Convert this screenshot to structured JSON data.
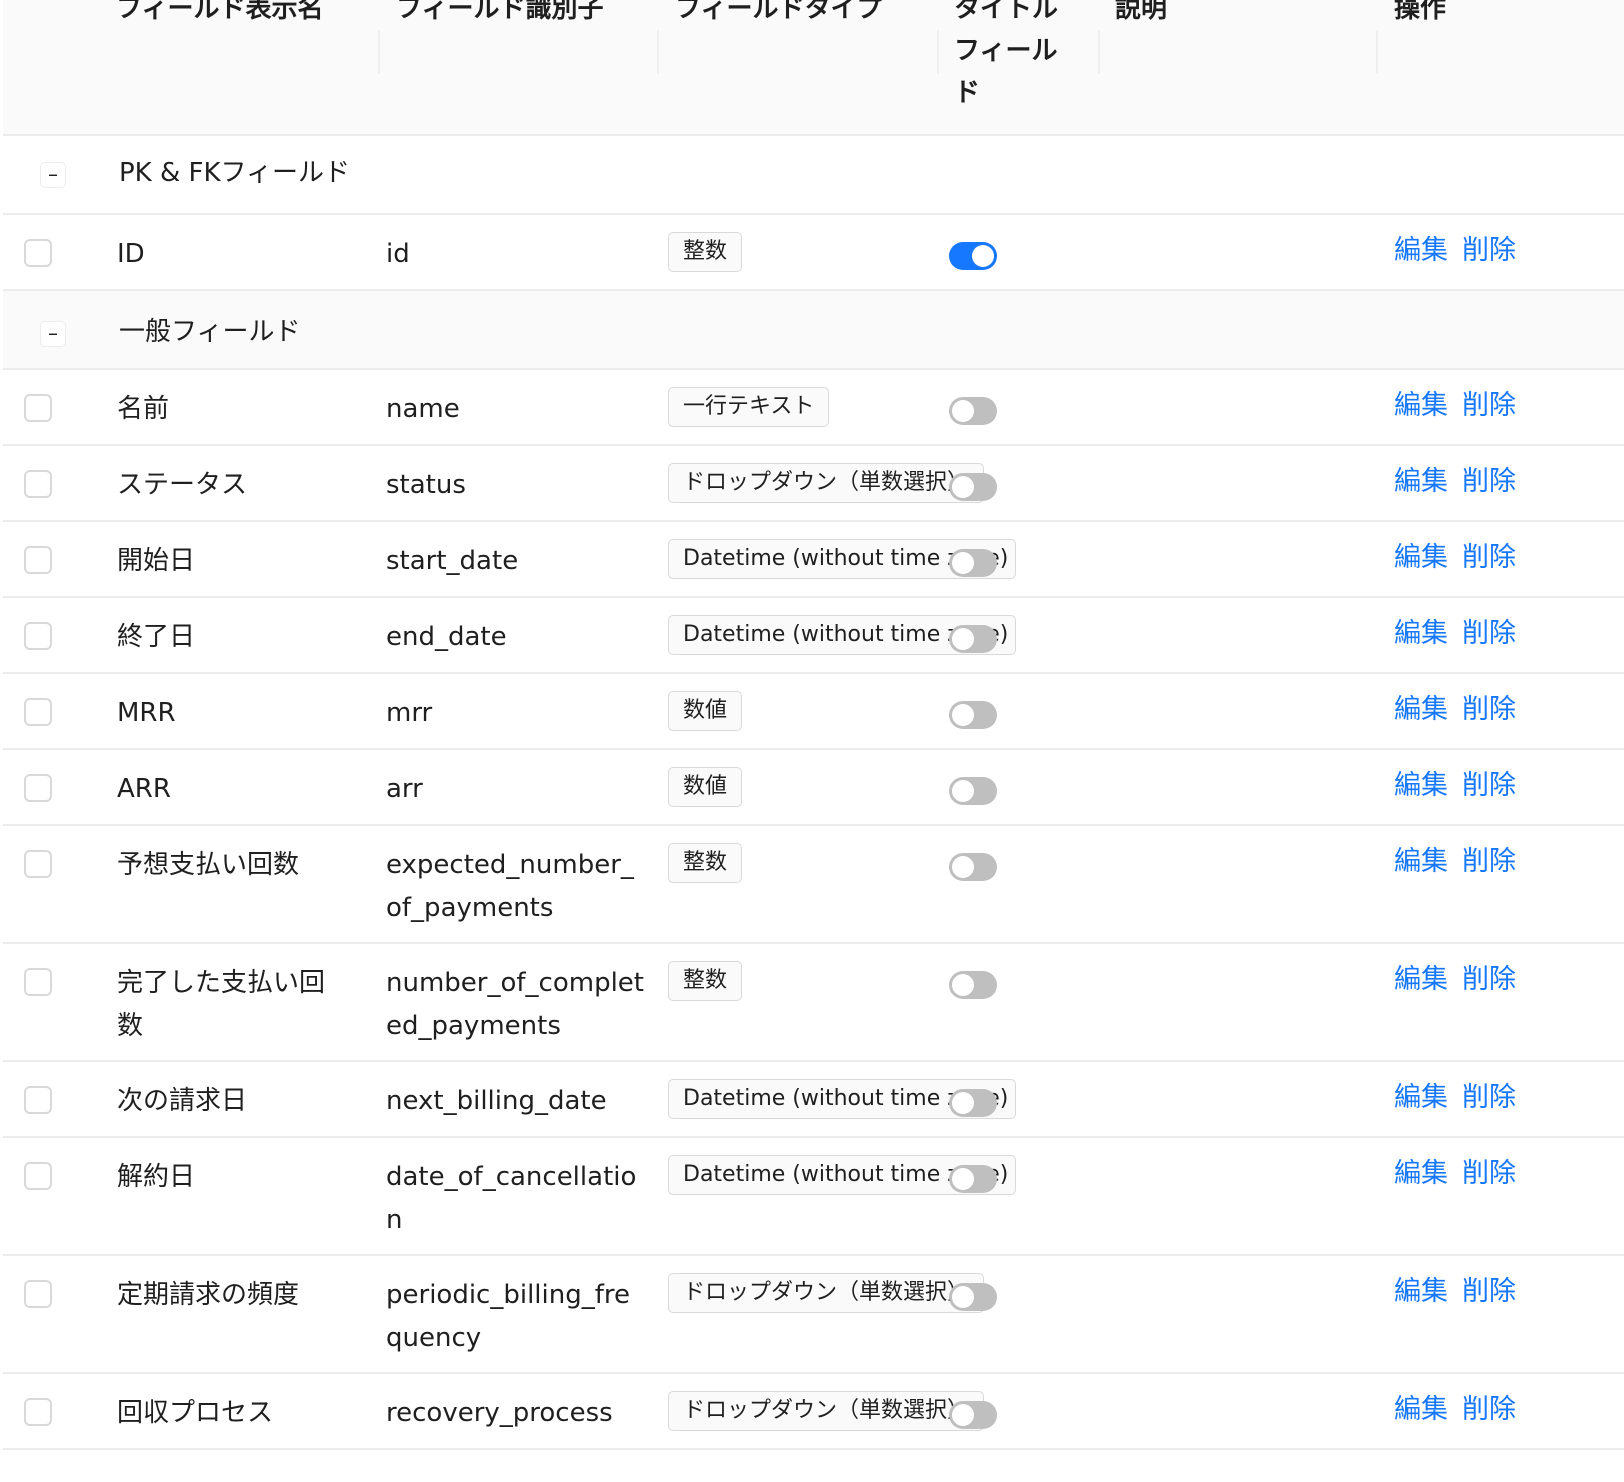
{
  "columns": {
    "display_name": "フィールド表示名",
    "identifier": "フィールド識別子",
    "type": "フィールドタイプ",
    "title_field": "タイトルフィールド",
    "title_field_lines": [
      "タイトル",
      "フィール",
      "ド"
    ],
    "description": "説明",
    "actions": "操作"
  },
  "groups": {
    "pk": {
      "label": "PK & FKフィールド",
      "expand_symbol": "–"
    },
    "general": {
      "label": "一般フィールド",
      "expand_symbol": "–"
    }
  },
  "action_labels": {
    "edit": "編集",
    "delete": "削除"
  },
  "colors": {
    "accent": "#1677ff",
    "toggle_off": "#bfbfbf",
    "header_bg": "#fafafa"
  },
  "rows": [
    {
      "name": "ID",
      "id": "id",
      "type": "整数",
      "title_field": true,
      "group": "pk"
    },
    {
      "name": "名前",
      "id": "name",
      "type": "一行テキスト",
      "title_field": false,
      "group": "general"
    },
    {
      "name": "ステータス",
      "id": "status",
      "type": "ドロップダウン（単数選択）",
      "title_field": false,
      "group": "general"
    },
    {
      "name": "開始日",
      "id": "start_date",
      "type": "Datetime (without time zone)",
      "title_field": false,
      "group": "general"
    },
    {
      "name": "終了日",
      "id": "end_date",
      "type": "Datetime (without time zone)",
      "title_field": false,
      "group": "general"
    },
    {
      "name": "MRR",
      "id": "mrr",
      "type": "数値",
      "title_field": false,
      "group": "general"
    },
    {
      "name": "ARR",
      "id": "arr",
      "type": "数値",
      "title_field": false,
      "group": "general"
    },
    {
      "name": "予想支払い回数",
      "id": "expected_number_of_payments",
      "type": "整数",
      "title_field": false,
      "group": "general"
    },
    {
      "name": "完了した支払い回数",
      "id": "number_of_completed_payments",
      "type": "整数",
      "title_field": false,
      "group": "general"
    },
    {
      "name": "次の請求日",
      "id": "next_billing_date",
      "type": "Datetime (without time zone)",
      "title_field": false,
      "group": "general"
    },
    {
      "name": "解約日",
      "id": "date_of_cancellation",
      "type": "Datetime (without time zone)",
      "title_field": false,
      "group": "general"
    },
    {
      "name": "定期請求の頻度",
      "id": "periodic_billing_frequency",
      "type": "ドロップダウン（単数選択）",
      "title_field": false,
      "group": "general"
    },
    {
      "name": "回収プロセス",
      "id": "recovery_process",
      "type": "ドロップダウン（単数選択）",
      "title_field": false,
      "group": "general"
    }
  ]
}
